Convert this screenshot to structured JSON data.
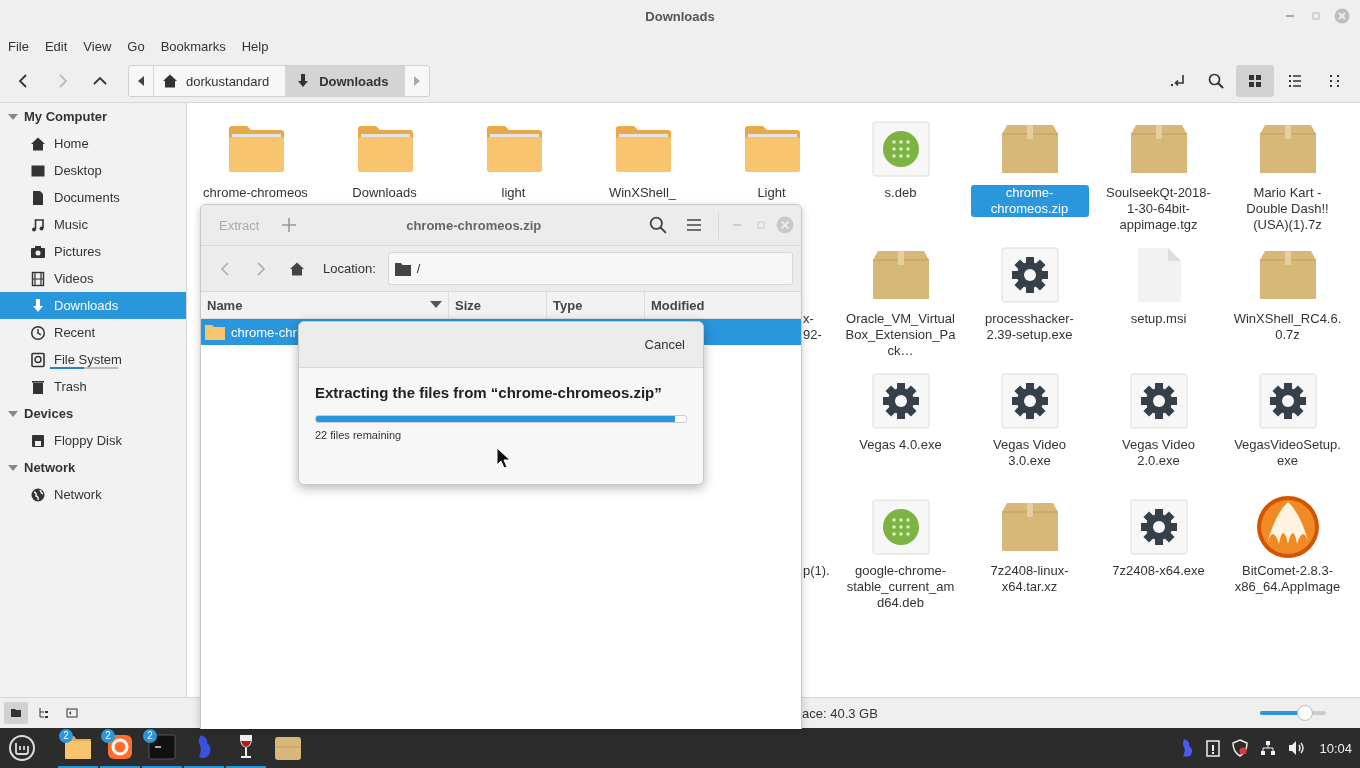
{
  "window": {
    "title": "Downloads"
  },
  "menu": [
    "File",
    "Edit",
    "View",
    "Go",
    "Bookmarks",
    "Help"
  ],
  "breadcrumbs": [
    {
      "label": "dorkustandard",
      "kind": "home",
      "selected": false
    },
    {
      "label": "Downloads",
      "kind": "downloads",
      "selected": true
    }
  ],
  "view_buttons": [
    {
      "kind": "icons",
      "selected": true
    },
    {
      "kind": "list",
      "selected": false
    },
    {
      "kind": "compact",
      "selected": false
    }
  ],
  "sidebar": [
    {
      "title": "My Computer",
      "expanded": true,
      "items": [
        {
          "label": "Home",
          "kind": "home",
          "selected": false
        },
        {
          "label": "Desktop",
          "kind": "desktop",
          "selected": false
        },
        {
          "label": "Documents",
          "kind": "documents",
          "selected": false
        },
        {
          "label": "Music",
          "kind": "music",
          "selected": false
        },
        {
          "label": "Pictures",
          "kind": "pictures",
          "selected": false
        },
        {
          "label": "Videos",
          "kind": "videos",
          "selected": false
        },
        {
          "label": "Downloads",
          "kind": "downloads",
          "selected": true
        },
        {
          "label": "Recent",
          "kind": "recent",
          "selected": false
        },
        {
          "label": "File System",
          "kind": "filesystem",
          "selected": false,
          "level": 0.5
        },
        {
          "label": "Trash",
          "kind": "trash",
          "selected": false
        }
      ]
    },
    {
      "title": "Devices",
      "expanded": true,
      "items": [
        {
          "label": "Floppy Disk",
          "kind": "floppy",
          "selected": false
        }
      ]
    },
    {
      "title": "Network",
      "expanded": true,
      "items": [
        {
          "label": "Network",
          "kind": "network",
          "selected": false
        }
      ]
    }
  ],
  "files": [
    {
      "items": [
        {
          "name": "chrome-chromeos",
          "kind": "folder",
          "selected": false
        },
        {
          "name": "Downloads",
          "kind": "folder",
          "selected": false
        },
        {
          "name": "light",
          "kind": "folder",
          "selected": false
        },
        {
          "name": "WinXShell_",
          "kind": "folder",
          "selected": false
        },
        {
          "name": "Light",
          "kind": "folder",
          "selected": false
        },
        {
          "name": "s.deb",
          "kind": "deb",
          "selected": false
        },
        {
          "name": "chrome-chromeos.zip",
          "kind": "package",
          "selected": true
        },
        {
          "name": "SoulseekQt-2018-1-30-64bit-appimage.tgz",
          "kind": "package",
          "selected": false
        },
        {
          "name": "Mario Kart - Double Dash!! (USA)(1).7z",
          "kind": "package",
          "selected": false
        }
      ]
    },
    {
      "items": [
        {
          "name": "x-92-",
          "kind": "covered",
          "selected": false
        },
        {
          "name": "Oracle_VM_VirtualBox_Extension_Pack…",
          "kind": "package",
          "selected": false
        },
        {
          "name": "processhacker-2.39-setup.exe",
          "kind": "gear",
          "selected": false
        },
        {
          "name": "setup.msi",
          "kind": "blank",
          "selected": false
        },
        {
          "name": "WinXShell_RC4.6.0.7z",
          "kind": "package",
          "selected": false
        }
      ]
    },
    {
      "items": [
        {
          "name": "Vegas 4.0.exe",
          "kind": "gear",
          "selected": false
        },
        {
          "name": "Vegas Video 3.0.exe",
          "kind": "gear",
          "selected": false
        },
        {
          "name": "Vegas Video 2.0.exe",
          "kind": "gear",
          "selected": false
        },
        {
          "name": "VegasVideoSetup.exe",
          "kind": "gear",
          "selected": false
        }
      ]
    },
    {
      "items": [
        {
          "name": "p(1).",
          "kind": "covered",
          "selected": false
        },
        {
          "name": "google-chrome-stable_current_amd64.deb",
          "kind": "deb",
          "selected": false
        },
        {
          "name": "7z2408-linux-x64.tar.xz",
          "kind": "package",
          "selected": false
        },
        {
          "name": "7z2408-x64.exe",
          "kind": "gear",
          "selected": false
        },
        {
          "name": "BitComet-2.8.3-x86_64.AppImage",
          "kind": "comet",
          "selected": false
        }
      ]
    }
  ],
  "status_bar": {
    "buttons": [
      {
        "kind": "places",
        "selected": true
      },
      {
        "kind": "tree",
        "selected": false
      },
      {
        "kind": "hide",
        "selected": false
      }
    ],
    "free_space": "ace: 40.3 GB",
    "zoom": {
      "level": 0.68
    }
  },
  "archive_window": {
    "title": "chrome-chromeos.zip",
    "extract": {
      "label": "Extract",
      "disabled": true
    },
    "location_label": "Location:",
    "location": "/",
    "columns": [
      {
        "label": "Name",
        "sorted": true
      },
      {
        "label": "Size",
        "sorted": false
      },
      {
        "label": "Type",
        "sorted": false
      },
      {
        "label": "Modified",
        "sorted": false
      }
    ],
    "rows": [
      {
        "name": "chrome-chr",
        "selected": true
      }
    ]
  },
  "progress_dialog": {
    "cancel": "Cancel",
    "title": "Extracting the files from “chrome-chromeos.zip”",
    "level": 0.97,
    "status": "22 files remaining"
  },
  "taskbar": {
    "apps": [
      {
        "kind": "files",
        "badge": "2",
        "running": true
      },
      {
        "kind": "browser",
        "badge": "2",
        "running": true
      },
      {
        "kind": "terminal",
        "badge": "2",
        "running": true
      },
      {
        "kind": "figure",
        "running": true
      },
      {
        "kind": "wine",
        "running": true
      },
      {
        "kind": "package",
        "running": false
      }
    ],
    "clock": "10:04"
  }
}
